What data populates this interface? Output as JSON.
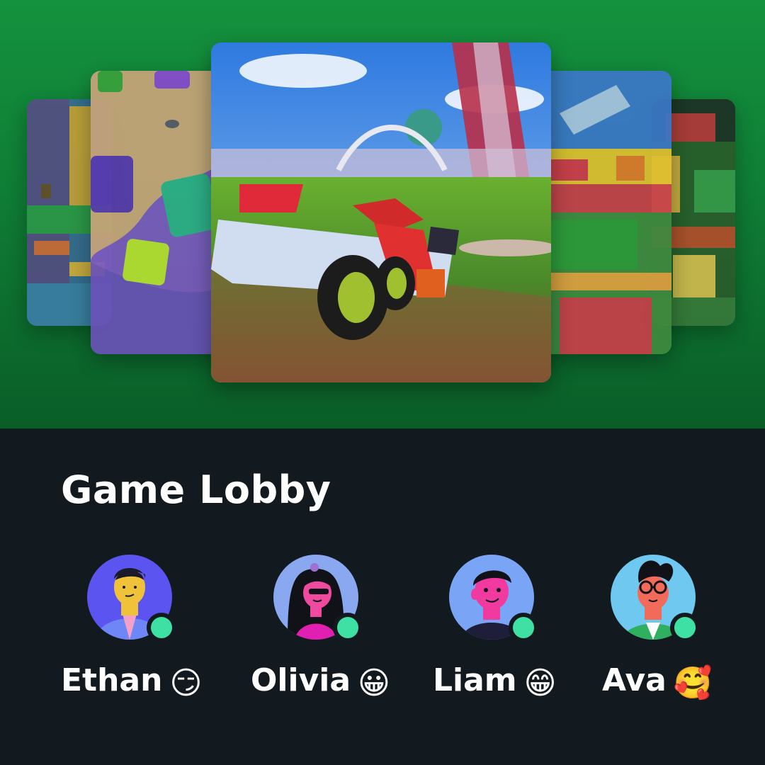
{
  "lobby": {
    "title": "Game Lobby"
  },
  "carousel": {
    "items": [
      {
        "game": "block-world"
      },
      {
        "game": "candy-cubes"
      },
      {
        "game": "kart-racer"
      },
      {
        "game": "brick-plaza"
      },
      {
        "game": "block-village"
      }
    ],
    "active_index": 2
  },
  "players": [
    {
      "name": "Ethan",
      "emoji": "😏",
      "status": "online",
      "status_color": "#3fe0a3",
      "avatar_bg": "#5b54f0"
    },
    {
      "name": "Olivia",
      "emoji": "😀",
      "status": "online",
      "status_color": "#3fe0a3",
      "avatar_bg": "#8aa8f0"
    },
    {
      "name": "Liam",
      "emoji": "😁",
      "status": "online",
      "status_color": "#3fe0a3",
      "avatar_bg": "#7aa4f5"
    },
    {
      "name": "Ava",
      "emoji": "🥰",
      "status": "online",
      "status_color": "#3fe0a3",
      "avatar_bg": "#6ec8f0"
    }
  ],
  "theme": {
    "hero_green": "#14923e",
    "background": "#121a1f",
    "online": "#3fe0a3"
  }
}
